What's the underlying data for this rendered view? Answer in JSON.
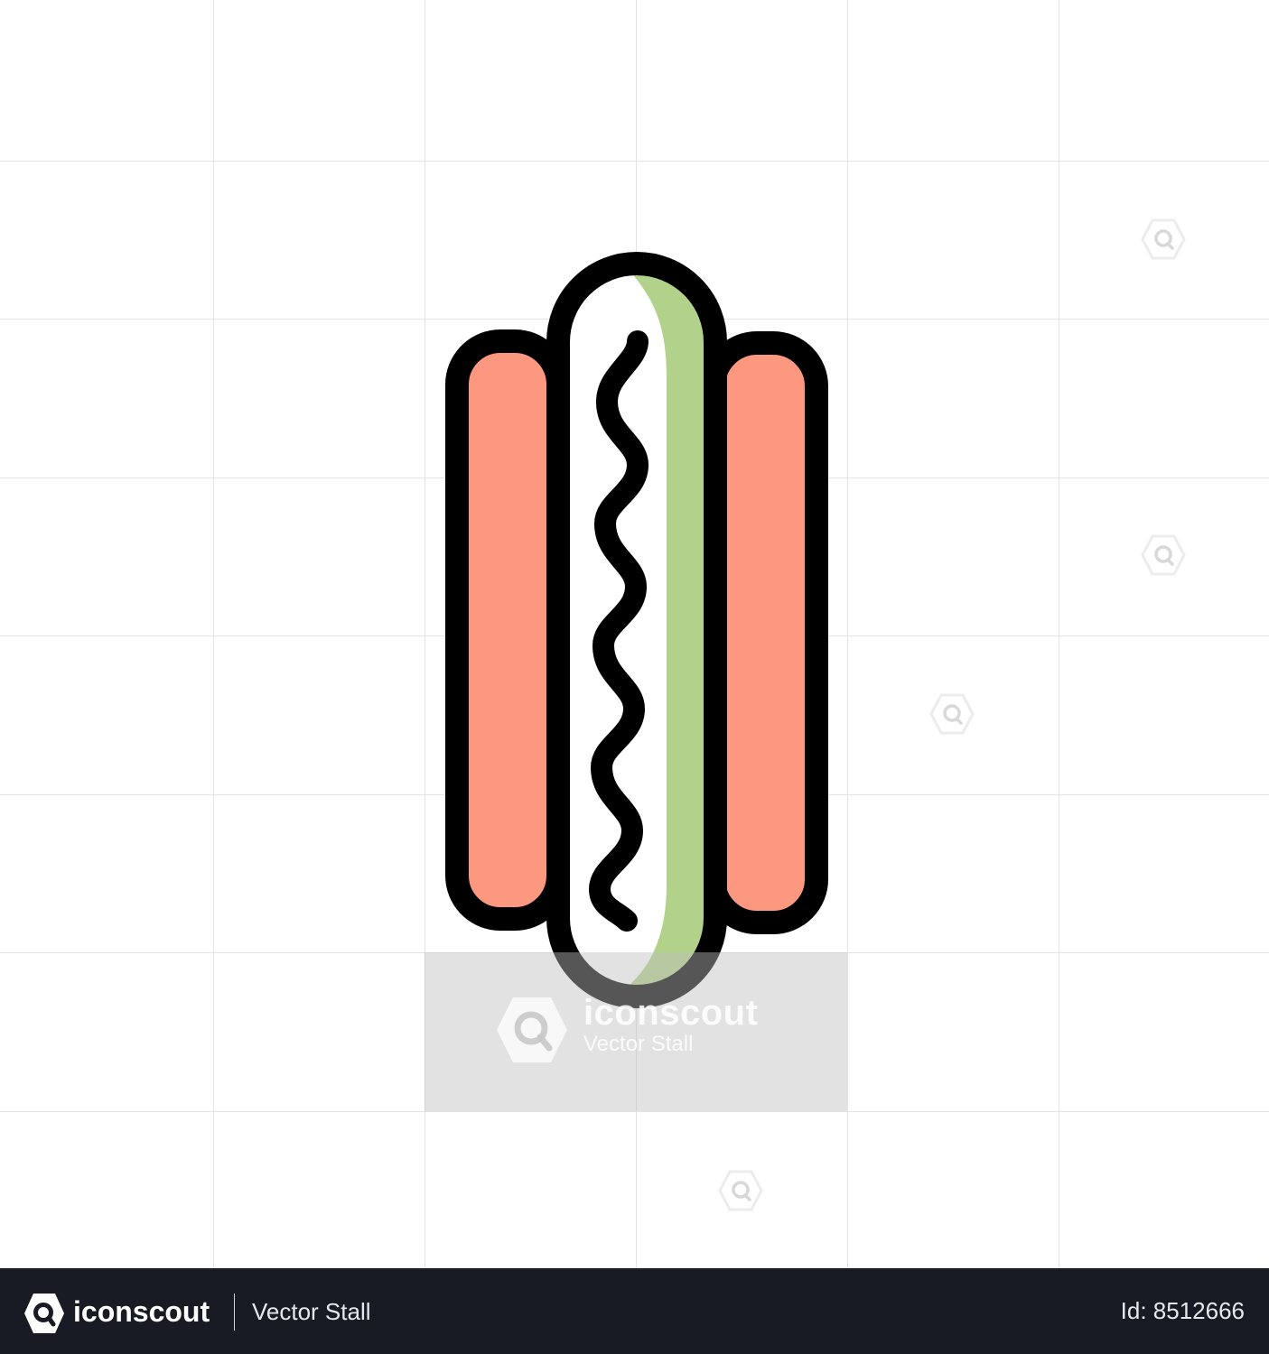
{
  "illustration": {
    "subject": "hot dog icon",
    "colors": {
      "outline": "#000000",
      "bun": "#fd9880",
      "sausage_shade": "#b2d18a",
      "sausage_base": "#ffffff",
      "background": "#ffffff",
      "grid": "#e3e3e3"
    }
  },
  "watermark": {
    "brand": "iconscout",
    "author": "Vector Stall",
    "icon": "iconscout-logo-icon"
  },
  "footer": {
    "brand": "iconscout",
    "author": "Vector Stall",
    "asset_id": "Id: 8512666",
    "background": "#181b24"
  }
}
